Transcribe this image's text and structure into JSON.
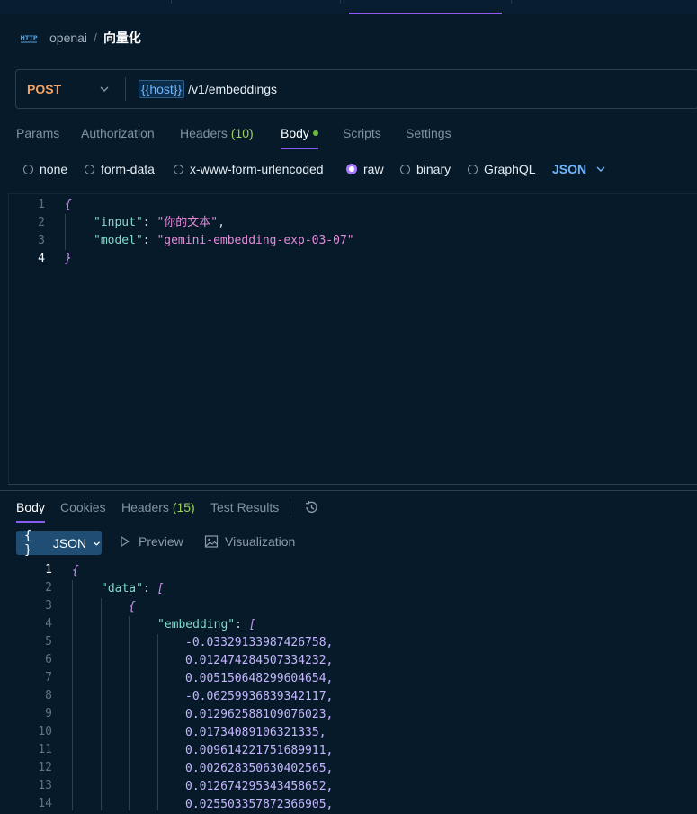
{
  "breadcrumb": {
    "icon": "http-icon",
    "icon_text": "HTTP",
    "parent": "openai",
    "separator": "/",
    "current": "向量化"
  },
  "request": {
    "method": "POST",
    "url_variable": "{{host}}",
    "url_path": "/v1/embeddings"
  },
  "request_tabs": {
    "params": "Params",
    "authorization": "Authorization",
    "headers": "Headers",
    "headers_count": "(10)",
    "body": "Body",
    "scripts": "Scripts",
    "settings": "Settings",
    "active": "Body"
  },
  "body_types": {
    "none": "none",
    "form_data": "form-data",
    "urlencoded": "x-www-form-urlencoded",
    "raw": "raw",
    "binary": "binary",
    "graphql": "GraphQL",
    "selected": "raw",
    "language": "JSON"
  },
  "request_body": {
    "line_numbers": [
      "1",
      "2",
      "3",
      "4"
    ],
    "open_brace": "{",
    "close_brace": "}",
    "input_key": "\"input\"",
    "input_value": "\"你的文本\"",
    "model_key": "\"model\"",
    "model_value": "\"gemini-embedding-exp-03-07\""
  },
  "response_tabs": {
    "body": "Body",
    "cookies": "Cookies",
    "headers": "Headers",
    "headers_count": "(15)",
    "test_results": "Test Results",
    "active": "Body"
  },
  "response_view": {
    "format": "JSON",
    "format_icon": "{ }",
    "preview": "Preview",
    "visualization": "Visualization"
  },
  "response_body": {
    "line_numbers": [
      "1",
      "2",
      "3",
      "4",
      "5",
      "6",
      "7",
      "8",
      "9",
      "10",
      "11",
      "12",
      "13",
      "14"
    ],
    "open_brace": "{",
    "data_key": "\"data\"",
    "open_bracket": "[",
    "inner_brace": "{",
    "embedding_key": "\"embedding\"",
    "values": [
      "-0.03329133987426758,",
      "0.012474284507334232,",
      "0.005150648299604654,",
      "-0.06259936839342117,",
      "0.012962588109076023,",
      "0.01734089106321335,",
      "0.009614221751689911,",
      "0.002628350630402565,",
      "0.012674295343458652,",
      "0.025503357872366905,"
    ]
  },
  "colors": {
    "background": "#061a2a",
    "accent": "#8b5cf6",
    "method": "#f4a261",
    "count": "#9bd05a",
    "json_key": "#7fdbca",
    "json_string": "#e38bd8",
    "json_number": "#c4b5fd"
  }
}
